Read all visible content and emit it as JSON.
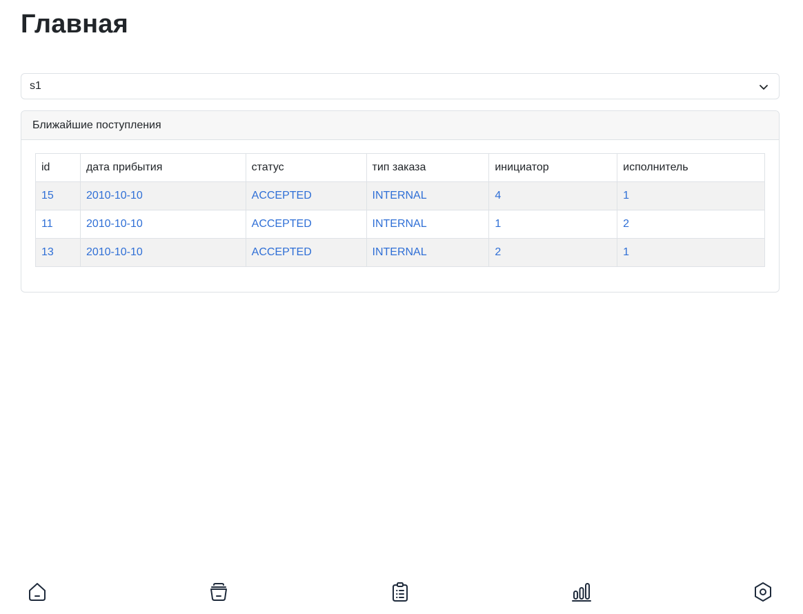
{
  "page": {
    "title": "Главная"
  },
  "storage_select": {
    "selected": "s1"
  },
  "card": {
    "header": "Ближайшие поступления"
  },
  "table": {
    "columns": [
      "id",
      "дата прибытия",
      "статус",
      "тип заказа",
      "инициатор",
      "исполнитель"
    ],
    "rows": [
      [
        "15",
        "2010-10-10",
        "ACCEPTED",
        "INTERNAL",
        "4",
        "1"
      ],
      [
        "11",
        "2010-10-10",
        "ACCEPTED",
        "INTERNAL",
        "1",
        "2"
      ],
      [
        "13",
        "2010-10-10",
        "ACCEPTED",
        "INTERNAL",
        "2",
        "1"
      ]
    ]
  },
  "bottom_nav": {
    "items": [
      {
        "icon": "home-icon"
      },
      {
        "icon": "basket-icon"
      },
      {
        "icon": "clipboard-list-icon"
      },
      {
        "icon": "bar-chart-icon"
      },
      {
        "icon": "settings-icon"
      }
    ]
  },
  "colors": {
    "link": "#2f6fd6",
    "border": "#dee2e6",
    "stripe": "#f2f2f2",
    "icon": "#1e2a3b"
  }
}
